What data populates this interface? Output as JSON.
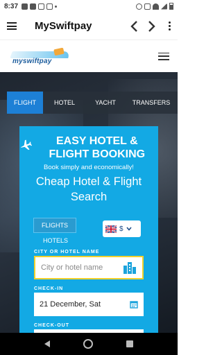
{
  "status_bar": {
    "time": "8:37"
  },
  "app_bar": {
    "title": "MySwiftpay"
  },
  "site": {
    "logo_text": "myswiftpay"
  },
  "search": {
    "tabs": [
      "FLIGHT",
      "HOTEL",
      "YACHT",
      "TRANSFERS"
    ],
    "heading": "EASY HOTEL & FLIGHT BOOKING",
    "tagline": "Book simply and economically!",
    "title": "Cheap Hotel & Flight Search",
    "mode_tabs": [
      "FLIGHTS",
      "HOTELS"
    ],
    "currency": "$",
    "city_label": "CITY OR HOTEL NAME",
    "city_placeholder": "City or hotel name",
    "checkin_label": "CHECK-IN",
    "checkin_value": "21 December, Sat",
    "checkout_label": "CHECK-OUT"
  },
  "colors": {
    "accent": "#13a9e4",
    "active_tab": "#1d80d6",
    "highlight_border": "#f2d12c"
  }
}
